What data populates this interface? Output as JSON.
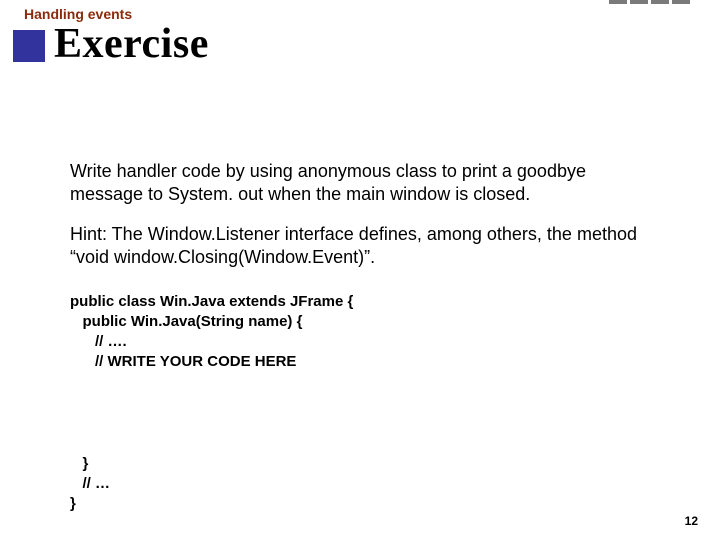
{
  "header": {
    "section": "Handling events",
    "title": "Exercise"
  },
  "body": {
    "para1": "Write handler code by using anonymous class to print a goodbye message to System. out when the main window is closed.",
    "para2": "Hint: The Window.Listener interface defines, among others, the method “void window.Closing(Window.Event)”."
  },
  "code": {
    "l1": "public class Win.Java extends JFrame {",
    "l2": "   public Win.Java(String name) {",
    "l3": "      // ….",
    "l4": "      // WRITE YOUR CODE HERE",
    "l5": "",
    "l6": "",
    "l7": "",
    "l8": "",
    "l9": "   }",
    "l10": "   // …",
    "l11": "}"
  },
  "page": "12"
}
